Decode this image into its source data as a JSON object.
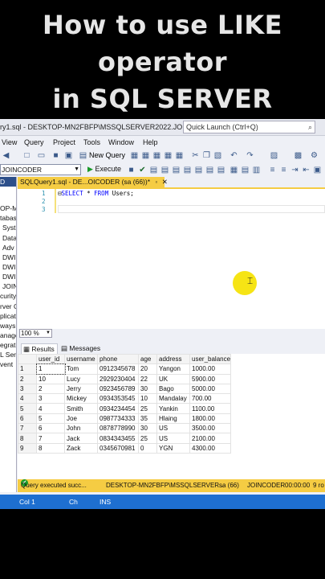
{
  "overlay_title": {
    "line1": "How to use LIKE",
    "line2": "operator",
    "line3": "in SQL SERVER"
  },
  "window": {
    "title": "ry1.sql - DESKTOP-MN2FBFP\\MSSQLSERVER2022.JOINCODER...",
    "quick_launch": "Quick Launch (Ctrl+Q)"
  },
  "menu": [
    "View",
    "Query",
    "Project",
    "Tools",
    "Window",
    "Help"
  ],
  "toolbar": {
    "new_query": "New Query",
    "execute": "Execute",
    "database": "JOINCODER"
  },
  "object_explorer": {
    "items": [
      "D",
      "OP-M",
      "tabas",
      "Syst",
      "Data",
      "Adv",
      "DWI",
      "DWI",
      "DWI",
      "JOIN",
      "curity",
      "rver O",
      "plicati",
      "ways",
      "anage",
      "egrati",
      "L Serv",
      "vent"
    ]
  },
  "editor": {
    "tab_label": "SQLQuery1.sql - DE...OICODER (sa (66))*",
    "line_numbers": [
      "1",
      "2",
      "3"
    ],
    "code_keyword1": "SELECT",
    "code_mid": " * ",
    "code_keyword2": "FROM",
    "code_rest": " Users;"
  },
  "zoom": "100 %",
  "results_tabs": {
    "results": "Results",
    "messages": "Messages"
  },
  "results": {
    "columns": [
      "user_id",
      "username",
      "phone",
      "age",
      "address",
      "user_balance"
    ],
    "rows": [
      [
        "1",
        "1",
        "Tom",
        "0912345678",
        "20",
        "Yangon",
        "1000.00"
      ],
      [
        "2",
        "10",
        "Lucy",
        "2929230404",
        "22",
        "UK",
        "5900.00"
      ],
      [
        "3",
        "2",
        "Jerry",
        "0923456789",
        "30",
        "Bago",
        "5000.00"
      ],
      [
        "4",
        "3",
        "Mickey",
        "0934353545",
        "10",
        "Mandalay",
        "700.00"
      ],
      [
        "5",
        "4",
        "Smith",
        "0934234454",
        "25",
        "Yankin",
        "1100.00"
      ],
      [
        "6",
        "5",
        "Joe",
        "0987734333",
        "35",
        "Hlaing",
        "1800.00"
      ],
      [
        "7",
        "6",
        "John",
        "0878778990",
        "30",
        "US",
        "3500.00"
      ],
      [
        "8",
        "7",
        "Jack",
        "0834343455",
        "25",
        "US",
        "2100.00"
      ],
      [
        "9",
        "8",
        "Zack",
        "0345670981",
        "0",
        "YGN",
        "4300.00"
      ]
    ]
  },
  "query_status": {
    "message": "Query executed succ...",
    "server": "DESKTOP-MN2FBFP\\MSSQLSERVER...",
    "user": "sa (66)",
    "db": "JOINCODER",
    "time": "00:00:00",
    "rows": "9 ro"
  },
  "statusbar": {
    "col": "Col 1",
    "ch": "Ch",
    "ins": "INS"
  }
}
